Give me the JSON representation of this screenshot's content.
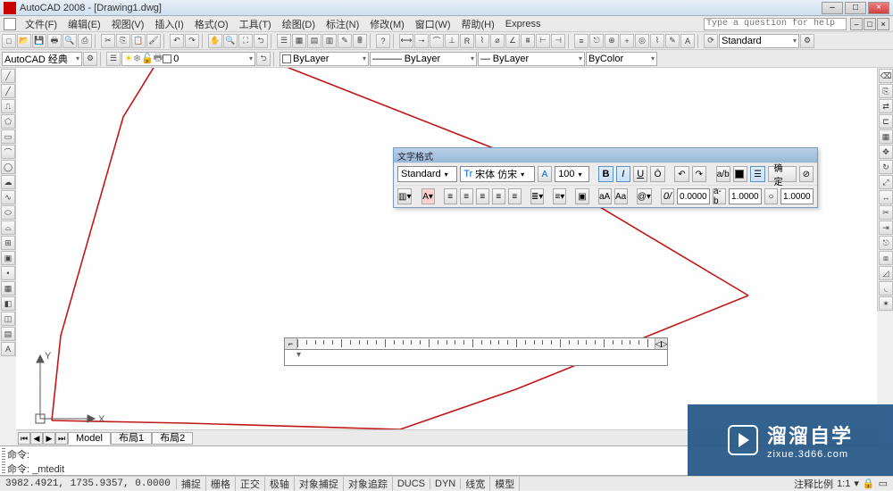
{
  "titlebar": {
    "title": "AutoCAD 2008 - [Drawing1.dwg]"
  },
  "menu": {
    "items": [
      "文件(F)",
      "编辑(E)",
      "视图(V)",
      "插入(I)",
      "格式(O)",
      "工具(T)",
      "绘图(D)",
      "标注(N)",
      "修改(M)",
      "窗口(W)",
      "帮助(H)",
      "Express"
    ],
    "help_placeholder": "Type a question for help"
  },
  "tb2": {
    "workspace": "AutoCAD 经典",
    "layer": "0",
    "layer_combo_width": 120,
    "linetype": "ByLayer",
    "lineweight": "ByLayer",
    "color": "ByColor",
    "style": "Standard"
  },
  "txtpanel": {
    "title": "文字格式",
    "style": "Standard",
    "font": "宋体 仿宋",
    "height": "100",
    "ok": "确定",
    "tracking": "0.0000",
    "widthfactor": "1.0000",
    "oblique": "1.0000"
  },
  "tabs": {
    "model": "Model",
    "layout1": "布局1",
    "layout2": "布局2"
  },
  "cmd": {
    "l1": "命令:",
    "l2": "命令: _mtedit"
  },
  "status": {
    "coords": "3982.4921, 1735.9357, 0.0000",
    "toggles": [
      "捕捉",
      "栅格",
      "正交",
      "极轴",
      "对象捕捉",
      "对象追踪",
      "DUCS",
      "DYN",
      "线宽",
      "模型"
    ],
    "annoscale": "注释比例",
    "ratio": "1:1"
  },
  "watermark": {
    "big": "溜溜自学",
    "small": "zixue.3d66.com"
  }
}
